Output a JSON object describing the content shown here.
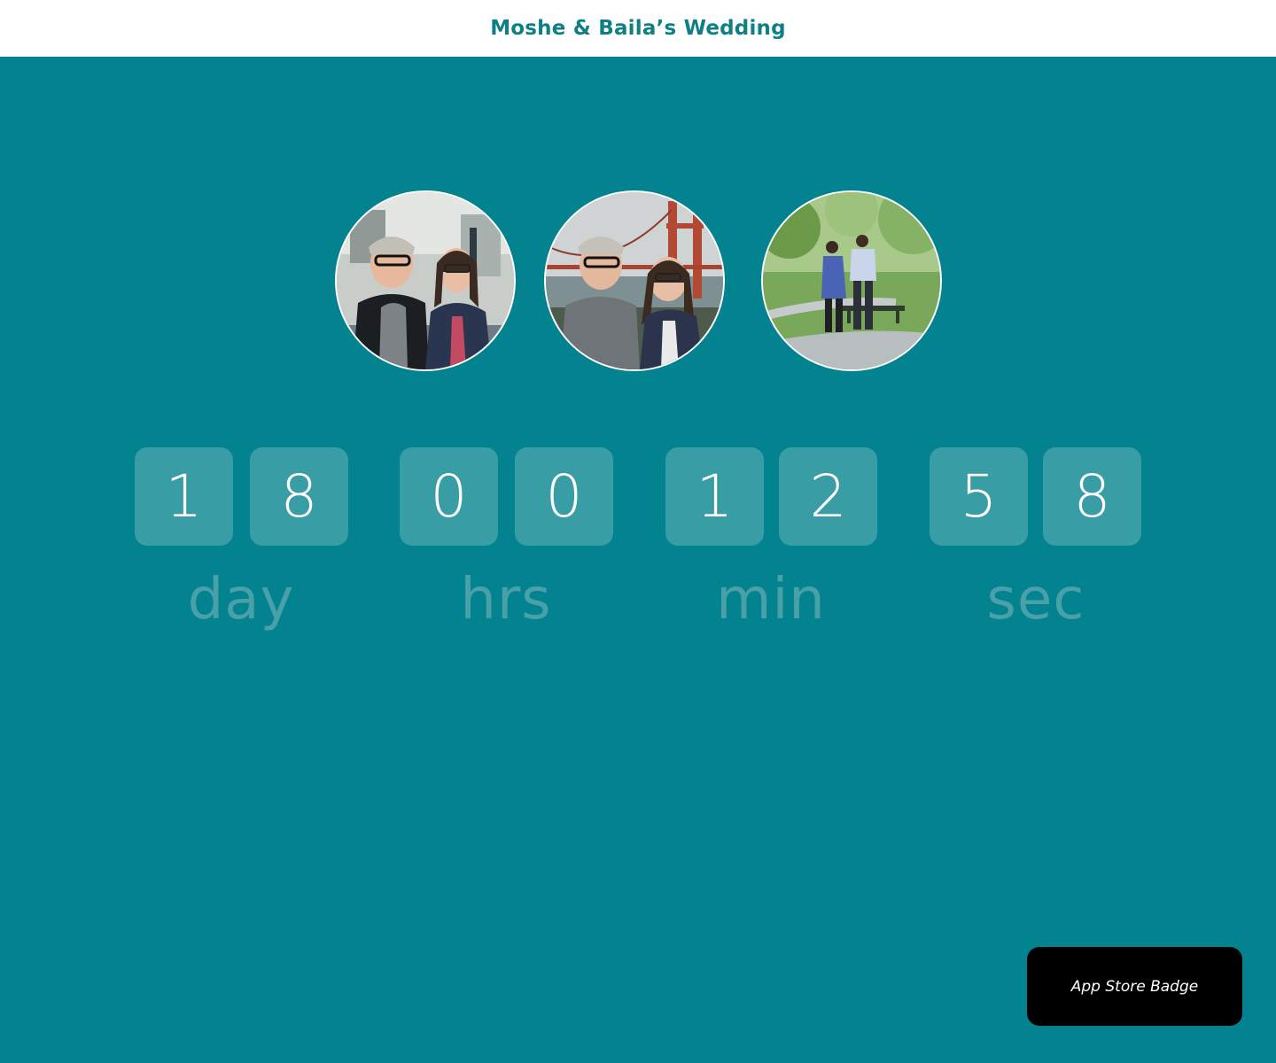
{
  "header": {
    "title": "Moshe & Baila’s Wedding"
  },
  "photos": [
    {
      "name": "couple-indoor-photo"
    },
    {
      "name": "couple-golden-gate-photo"
    },
    {
      "name": "couple-walking-park-photo"
    }
  ],
  "countdown": {
    "days": {
      "digits": [
        "1",
        "8"
      ],
      "label": "day"
    },
    "hours": {
      "digits": [
        "0",
        "0"
      ],
      "label": "hrs"
    },
    "minutes": {
      "digits": [
        "1",
        "2"
      ],
      "label": "min"
    },
    "seconds": {
      "digits": [
        "5",
        "8"
      ],
      "label": "sec"
    }
  },
  "badge": {
    "label": "App Store Badge"
  },
  "colors": {
    "background": "#02838f",
    "header_bg": "#ffffff",
    "title_text": "#0f7f86",
    "digit_tile": "#389da5",
    "digit_text": "#ffffff",
    "unit_label": "#4aa0a8",
    "badge_bg": "#000000"
  }
}
